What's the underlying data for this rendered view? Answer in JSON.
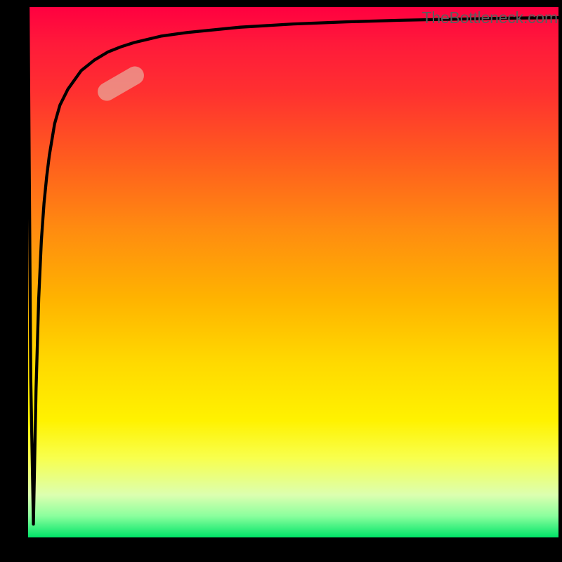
{
  "attribution": "TheBottleneck.com",
  "chart_data": {
    "type": "line",
    "title": "",
    "xlabel": "",
    "ylabel": "",
    "xlim": [
      0,
      100
    ],
    "ylim": [
      0,
      100
    ],
    "series": [
      {
        "name": "bottleneck-curve",
        "x": [
          0.0,
          0.5,
          1.0,
          1.5,
          2.0,
          2.5,
          3.0,
          3.5,
          4.0,
          5.0,
          6.0,
          7.5,
          10.0,
          12.5,
          15.0,
          17.5,
          20.0,
          25.0,
          30.0,
          40.0,
          50.0,
          60.0,
          70.0,
          80.0,
          90.0,
          100.0
        ],
        "y": [
          100.0,
          30.0,
          2.5,
          28.0,
          45.0,
          56.0,
          63.0,
          68.0,
          72.0,
          78.0,
          81.5,
          84.5,
          88.0,
          90.0,
          91.5,
          92.5,
          93.3,
          94.5,
          95.2,
          96.2,
          96.8,
          97.2,
          97.5,
          97.7,
          97.9,
          98.0
        ]
      }
    ],
    "marker": {
      "name": "highlight-segment",
      "x_center": 17.5,
      "y_center": 85.5,
      "angle_deg": -30
    },
    "background": {
      "type": "vertical-gradient",
      "stops": [
        {
          "pos": 0.0,
          "color": "#ff0040"
        },
        {
          "pos": 0.16,
          "color": "#ff3030"
        },
        {
          "pos": 0.42,
          "color": "#ff8c10"
        },
        {
          "pos": 0.67,
          "color": "#ffd900"
        },
        {
          "pos": 0.85,
          "color": "#f8ff4d"
        },
        {
          "pos": 0.96,
          "color": "#8aff9d"
        },
        {
          "pos": 1.0,
          "color": "#00e468"
        }
      ]
    }
  }
}
